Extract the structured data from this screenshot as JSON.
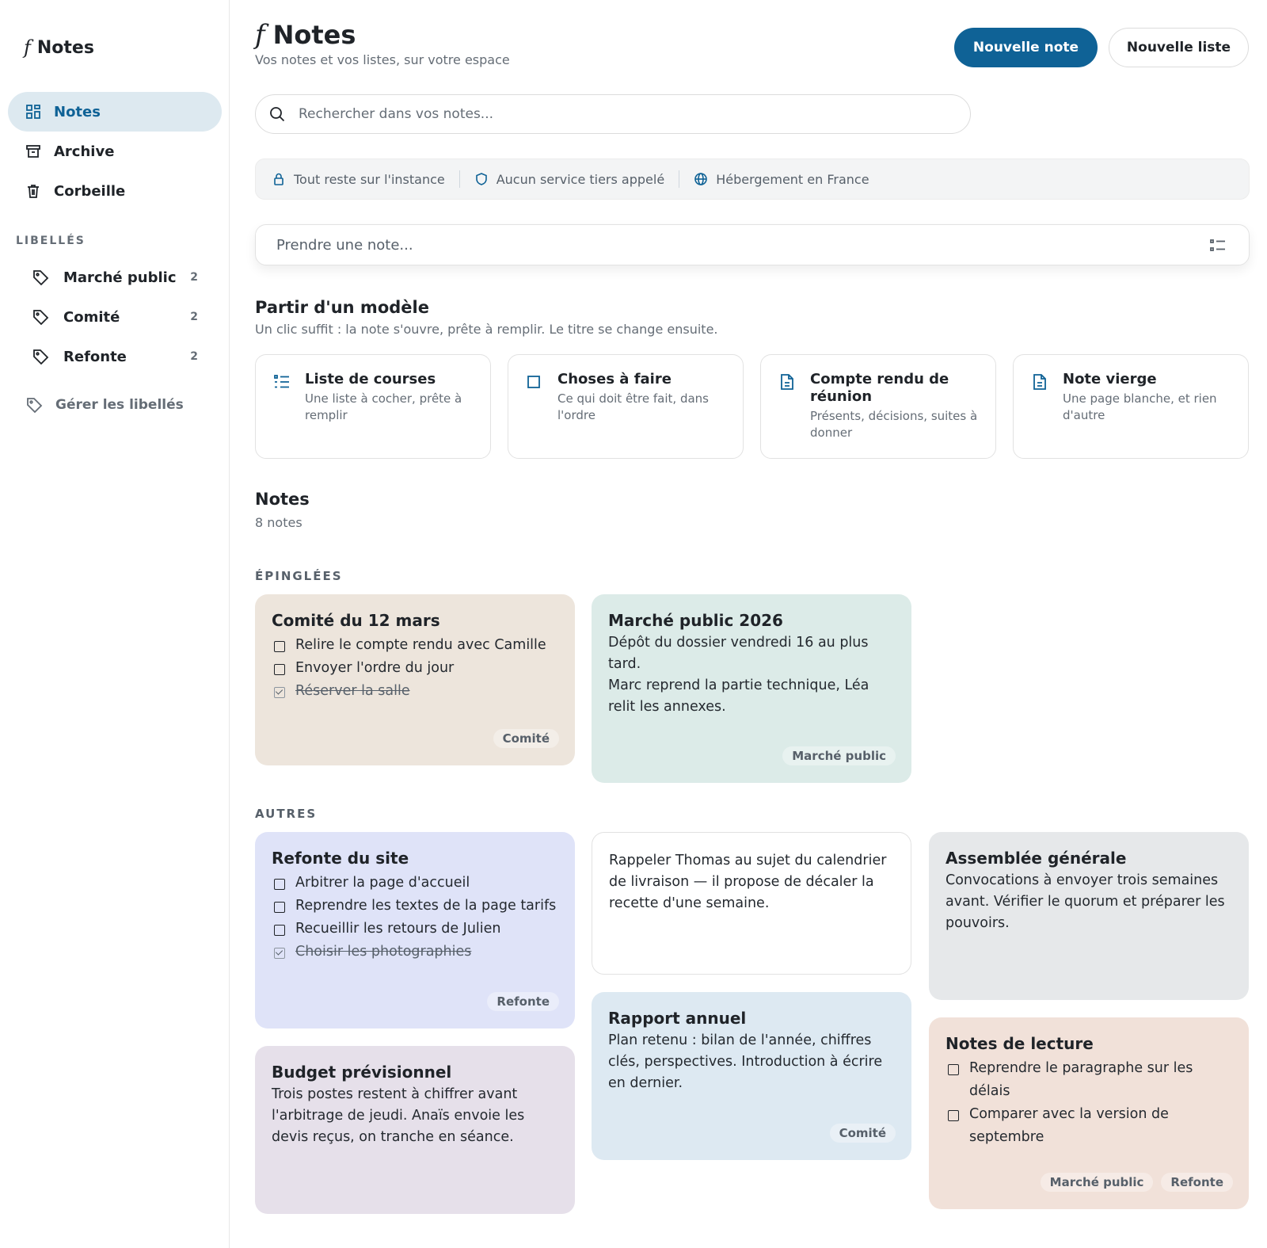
{
  "sidebar": {
    "brand": {
      "glyph": "f",
      "name": "Notes"
    },
    "nav": [
      {
        "label": "Notes",
        "icon": "grid-icon",
        "active": true
      },
      {
        "label": "Archive",
        "icon": "archive-icon"
      },
      {
        "label": "Corbeille",
        "icon": "trash-icon"
      }
    ],
    "labels_heading": "LIBELLÉS",
    "labels": [
      {
        "label": "Marché public",
        "count": "2"
      },
      {
        "label": "Comité",
        "count": "2"
      },
      {
        "label": "Refonte",
        "count": "2"
      }
    ],
    "manage_label": "Gérer les libellés"
  },
  "header": {
    "glyph": "f",
    "title": "Notes",
    "subtitle": "Vos notes et vos listes, sur votre espace",
    "new_note": "Nouvelle note",
    "new_list": "Nouvelle liste"
  },
  "search": {
    "placeholder": "Rechercher dans vos notes..."
  },
  "trust": [
    {
      "text": "Tout reste sur l'instance",
      "icon": "lock-icon"
    },
    {
      "text": "Aucun service tiers appelé",
      "icon": "shield-icon"
    },
    {
      "text": "Hébergement en France",
      "icon": "globe-icon"
    }
  ],
  "compose": {
    "placeholder": "Prendre une note..."
  },
  "templates": {
    "title": "Partir d'un modèle",
    "subtitle": "Un clic suffit : la note s'ouvre, prête à remplir. Le titre se change ensuite.",
    "items": [
      {
        "title": "Liste de courses",
        "desc": "Une liste à cocher, prête à remplir",
        "icon": "list-icon"
      },
      {
        "title": "Choses à faire",
        "desc": "Ce qui doit être fait, dans l'ordre",
        "icon": "checkbox-icon"
      },
      {
        "title": "Compte rendu de réunion",
        "desc": "Présents, décisions, suites à donner",
        "icon": "document-icon"
      },
      {
        "title": "Note vierge",
        "desc": "Une page blanche, et rien d'autre",
        "icon": "document-icon"
      }
    ]
  },
  "notes_section": {
    "title": "Notes",
    "count": "8 notes",
    "pinned_label": "ÉPINGLÉES",
    "others_label": "AUTRES"
  },
  "colors": {
    "accent": "#0f6296",
    "beige": "#ede5dc",
    "mint": "#dcebe8",
    "lavender": "#dfe3f8",
    "white": "#ffffff",
    "gray": "#e6e8ea",
    "blue": "#dde9f2",
    "mauve": "#e6e0ea",
    "peach": "#f1e1d9"
  },
  "pinned": [
    {
      "title": "Comité du 12 mars",
      "items": [
        {
          "text": "Relire le compte rendu avec Camille",
          "done": false
        },
        {
          "text": "Envoyer l'ordre du jour",
          "done": false
        },
        {
          "text": "Réserver la salle",
          "done": true
        }
      ],
      "tags": [
        "Comité"
      ]
    },
    {
      "title": "Marché public 2026",
      "body": [
        "Dépôt du dossier vendredi 16 au plus tard.",
        "Marc reprend la partie technique, Léa relit les annexes."
      ],
      "tags": [
        "Marché public"
      ]
    }
  ],
  "others": [
    {
      "title": "Refonte du site",
      "items": [
        {
          "text": "Arbitrer la page d'accueil",
          "done": false
        },
        {
          "text": "Reprendre les textes de la page tarifs",
          "done": false
        },
        {
          "text": "Recueillir les retours de Julien",
          "done": false
        },
        {
          "text": "Choisir les photographies",
          "done": true
        }
      ],
      "tags": [
        "Refonte"
      ]
    },
    {
      "title": "",
      "body": [
        "Rappeler Thomas au sujet du calendrier de livraison — il propose de décaler la recette d'une semaine."
      ],
      "tags": []
    },
    {
      "title": "Assemblée générale",
      "body": [
        "Convocations à envoyer trois semaines avant. Vérifier le quorum et préparer les pouvoirs."
      ],
      "tags": []
    },
    {
      "title": "Budget prévisionnel",
      "body": [
        "Trois postes restent à chiffrer avant l'arbitrage de jeudi. Anaïs envoie les devis reçus, on tranche en séance."
      ],
      "tags": []
    },
    {
      "title": "Rapport annuel",
      "body": [
        "Plan retenu : bilan de l'année, chiffres clés, perspectives. Introduction à écrire en dernier."
      ],
      "tags": [
        "Comité"
      ]
    },
    {
      "title": "Notes de lecture",
      "items": [
        {
          "text": "Reprendre le paragraphe sur les délais",
          "done": false
        },
        {
          "text": "Comparer avec la version de septembre",
          "done": false
        }
      ],
      "tags": [
        "Marché public",
        "Refonte"
      ]
    }
  ]
}
